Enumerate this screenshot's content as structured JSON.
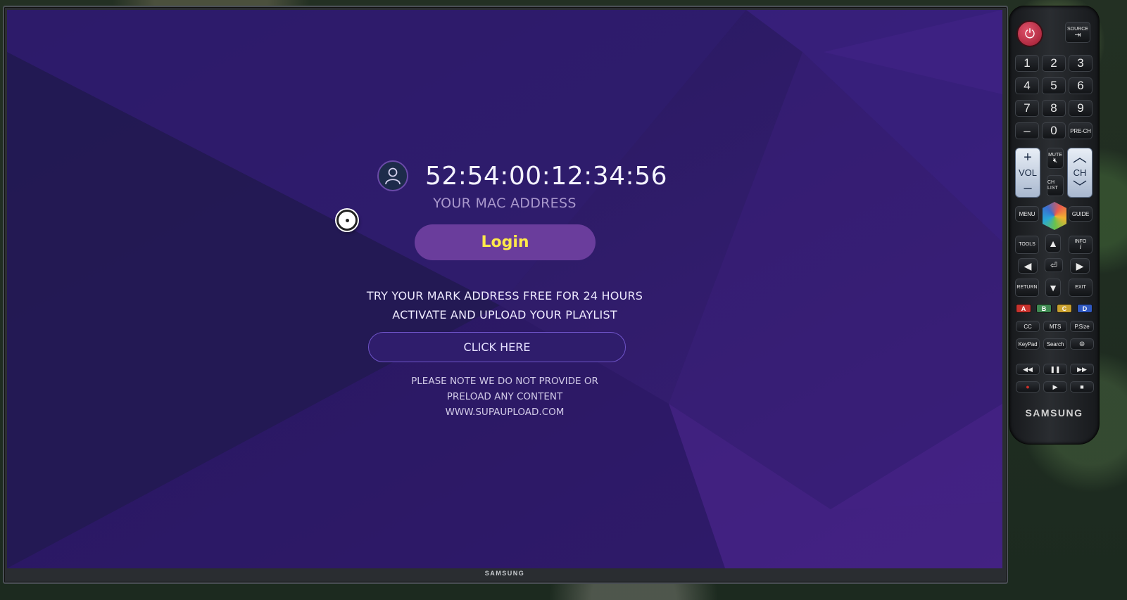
{
  "tv": {
    "brand": "SAMSUNG"
  },
  "app": {
    "mac_address": "52:54:00:12:34:56",
    "mac_label": "YOUR MAC ADDRESS",
    "login_label": "Login",
    "trial_line1": "TRY YOUR MARK ADDRESS FREE FOR 24 HOURS",
    "trial_line2": "ACTIVATE AND UPLOAD YOUR PLAYLIST",
    "click_here_label": "CLICK HERE",
    "note_line1": "PLEASE NOTE WE DO NOT PROVIDE OR",
    "note_line2": "PRELOAD ANY CONTENT",
    "note_line3": "WWW.SUPAUPLOAD.COM",
    "colors": {
      "background": "#2c1a66",
      "login_button": "#6a3d9c",
      "login_text": "#ffe94a",
      "outline_button": "#6f54c9"
    },
    "icons": {
      "avatar": "user-icon",
      "pointer": "pointer-cursor-icon"
    }
  },
  "remote": {
    "source": "SOURCE",
    "digits": [
      "1",
      "2",
      "3",
      "4",
      "5",
      "6",
      "7",
      "8",
      "9"
    ],
    "dash": "–",
    "zero": "0",
    "prech": "PRE-CH",
    "vol_plus": "+",
    "vol": "VOL",
    "vol_minus": "–",
    "mute": "MUTE",
    "ch_list": "CH LIST",
    "ch": "CH",
    "menu": "MENU",
    "guide": "GUIDE",
    "tools": "TOOLS",
    "info": "INFO",
    "return": "RETURN",
    "exit": "EXIT",
    "color_a": "A",
    "color_b": "B",
    "color_c": "C",
    "color_d": "D",
    "cc": "CC",
    "mts": "MTS",
    "psize": "P.Size",
    "keypad": "KeyPad",
    "search": "Search",
    "brand": "SAMSUNG"
  }
}
